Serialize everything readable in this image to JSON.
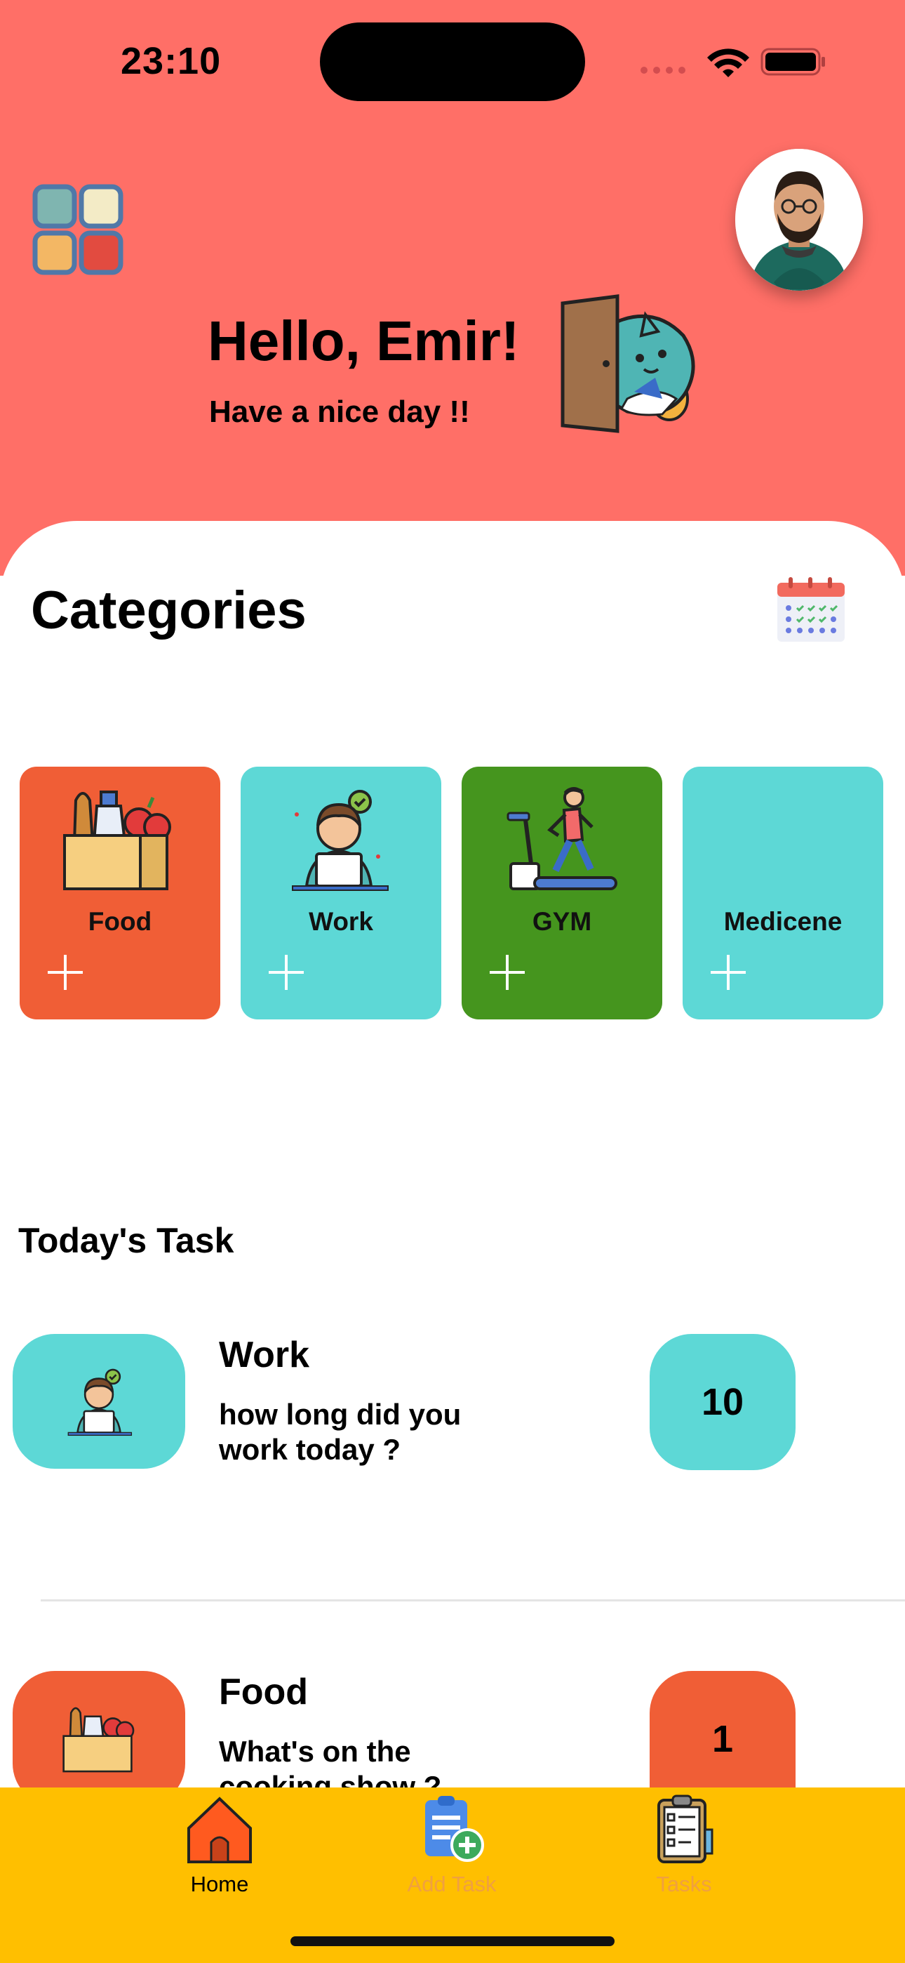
{
  "status_bar": {
    "time": "23:10"
  },
  "header": {
    "greeting": "Hello, Emir!",
    "subtitle": "Have a nice day !!"
  },
  "categories": {
    "title": "Categories",
    "items": [
      {
        "name": "Food",
        "color": "#F05E36",
        "icon": "grocery-bag-icon"
      },
      {
        "name": "Work",
        "color": "#5DD8D6",
        "icon": "person-laptop-icon"
      },
      {
        "name": "GYM",
        "color": "#45951E",
        "icon": "treadmill-runner-icon"
      },
      {
        "name": "Medicene",
        "color": "#5DD8D6",
        "icon": ""
      }
    ]
  },
  "today": {
    "title": "Today's Task",
    "tasks": [
      {
        "name": "Work",
        "description": "how long did you work today ?",
        "count": "10",
        "color": "#5DD8D6",
        "icon": "person-laptop-icon"
      },
      {
        "name": "Food",
        "description": "What's on the cooking show ?",
        "count": "1",
        "color": "#F05E36",
        "icon": "grocery-bag-icon"
      }
    ]
  },
  "tabbar": {
    "items": [
      {
        "label": "Home",
        "active": true,
        "icon": "home-icon"
      },
      {
        "label": "Add Task",
        "active": false,
        "icon": "add-document-icon"
      },
      {
        "label": "Tasks",
        "active": false,
        "icon": "clipboard-checklist-icon"
      }
    ]
  },
  "colors": {
    "header": "#FF6F67",
    "tabbar": "#FFBF00",
    "inactive_tab_text": "#F0A040"
  }
}
